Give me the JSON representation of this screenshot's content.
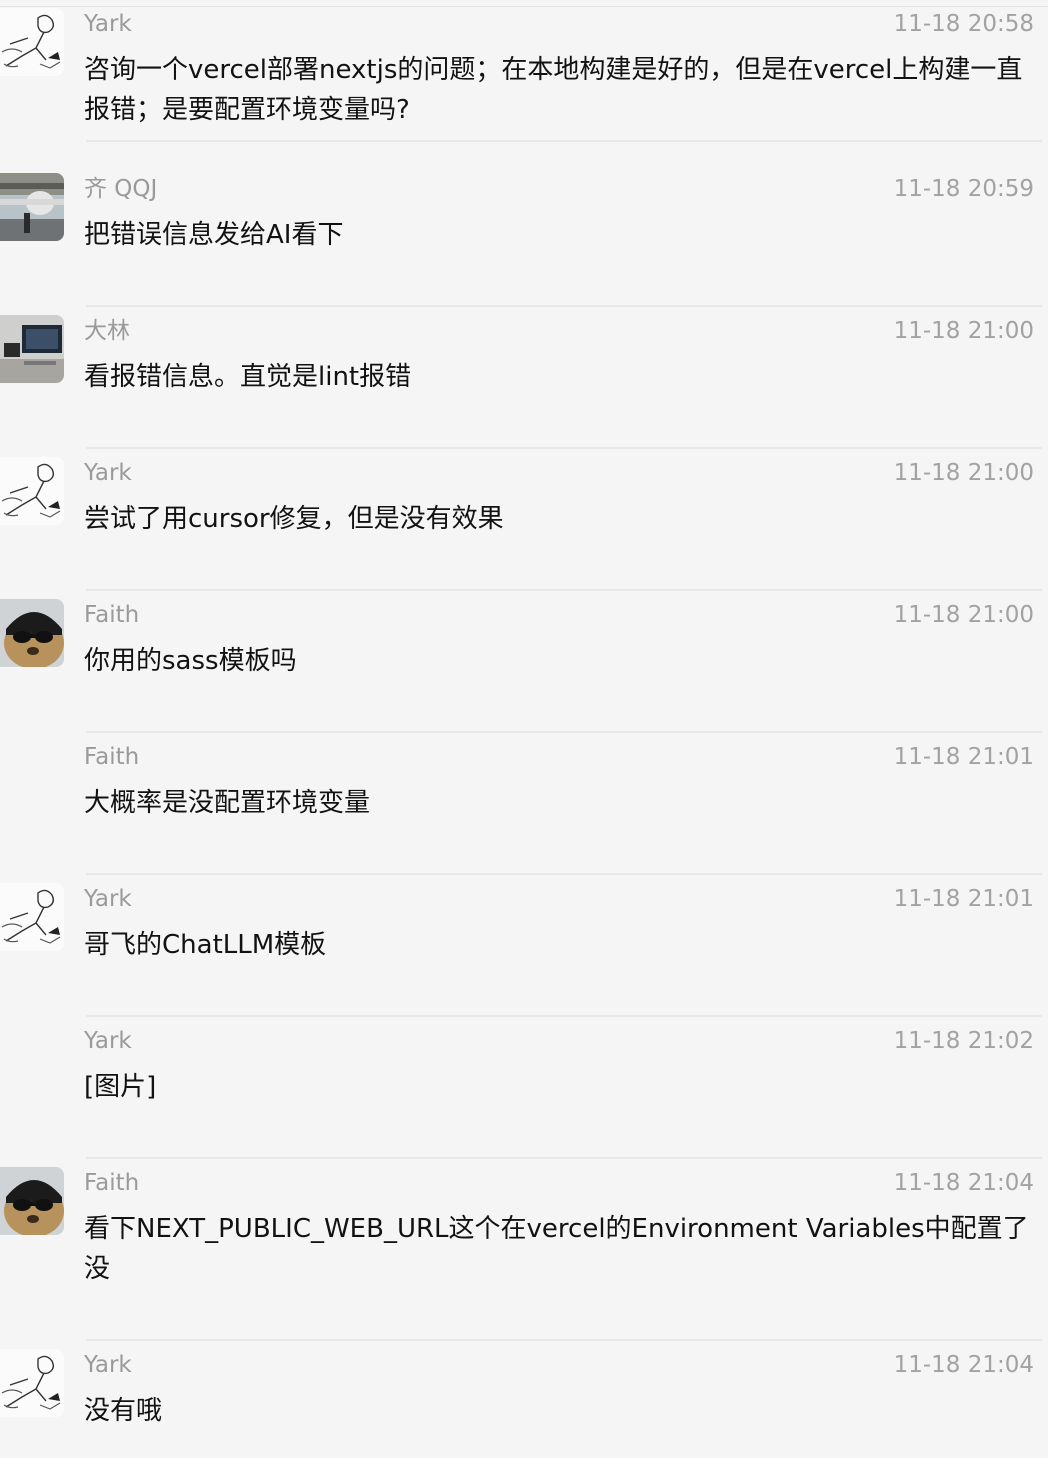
{
  "messages": [
    {
      "author": "Yark",
      "time": "11-18 20:58",
      "avatar": "sketch-avatar",
      "text": "咨询一个vercel部署nextjs的问题；在本地构建是好的，但是在vercel上构建一直报错；是要配置环境变量吗?"
    },
    {
      "author": "齐 QQJ",
      "time": "11-18 20:59",
      "avatar": "aircraft-photo-avatar",
      "text": "把错误信息发给AI看下"
    },
    {
      "author": "大林",
      "time": "11-18 21:00",
      "avatar": "desk-setup-avatar",
      "text": "看报错信息。直觉是lint报错"
    },
    {
      "author": "Yark",
      "time": "11-18 21:00",
      "avatar": "sketch-avatar",
      "text": "尝试了用cursor修复，但是没有效果"
    },
    {
      "author": "Faith",
      "time": "11-18 21:00",
      "avatar": "bear-sunglasses-avatar",
      "text": "你用的sass模板吗"
    },
    {
      "author": "Faith",
      "time": "11-18 21:01",
      "avatar": "",
      "text": "大概率是没配置环境变量"
    },
    {
      "author": "Yark",
      "time": "11-18 21:01",
      "avatar": "sketch-avatar",
      "text": "哥飞的ChatLLM模板"
    },
    {
      "author": "Yark",
      "time": "11-18 21:02",
      "avatar": "",
      "text": "[图片]"
    },
    {
      "author": "Faith",
      "time": "11-18 21:04",
      "avatar": "bear-sunglasses-avatar",
      "text": "看下NEXT_PUBLIC_WEB_URL这个在vercel的Environment Variables中配置了没"
    },
    {
      "author": "Yark",
      "time": "11-18 21:04",
      "avatar": "sketch-avatar",
      "text": "没有哦"
    }
  ]
}
